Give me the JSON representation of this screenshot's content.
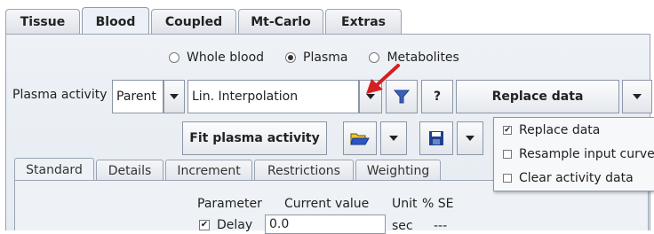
{
  "top_tabs": [
    "Tissue",
    "Blood",
    "Coupled",
    "Mt-Carlo",
    "Extras"
  ],
  "active_top_tab": "Blood",
  "blood_type": {
    "options": [
      "Whole blood",
      "Plasma",
      "Metabolites"
    ],
    "selected": "Plasma"
  },
  "plasma_activity": {
    "label": "Plasma activity",
    "source_value": "Parent",
    "model_value": "Lin. Interpolation",
    "help_label": "?",
    "replace_button": "Replace data"
  },
  "fit_button": "Fit plasma activity",
  "replace_menu": {
    "items": [
      {
        "label": "Replace data",
        "checked": true
      },
      {
        "label": "Resample input curve",
        "checked": false
      },
      {
        "label": "Clear activity data",
        "checked": false
      }
    ]
  },
  "sub_tabs": [
    "Standard",
    "Details",
    "Increment",
    "Restrictions",
    "Weighting"
  ],
  "active_sub_tab": "Standard",
  "param_table": {
    "headers": [
      "Parameter",
      "Current value",
      "Unit",
      "% SE"
    ],
    "rows": [
      {
        "name": "Delay",
        "checked": true,
        "value": "0.0",
        "unit": "sec",
        "se": "---"
      }
    ]
  },
  "colors": {
    "accent_arrow": "#d42020",
    "save_icon": "#1f3f8f",
    "open_icon": "#2a56c6"
  }
}
